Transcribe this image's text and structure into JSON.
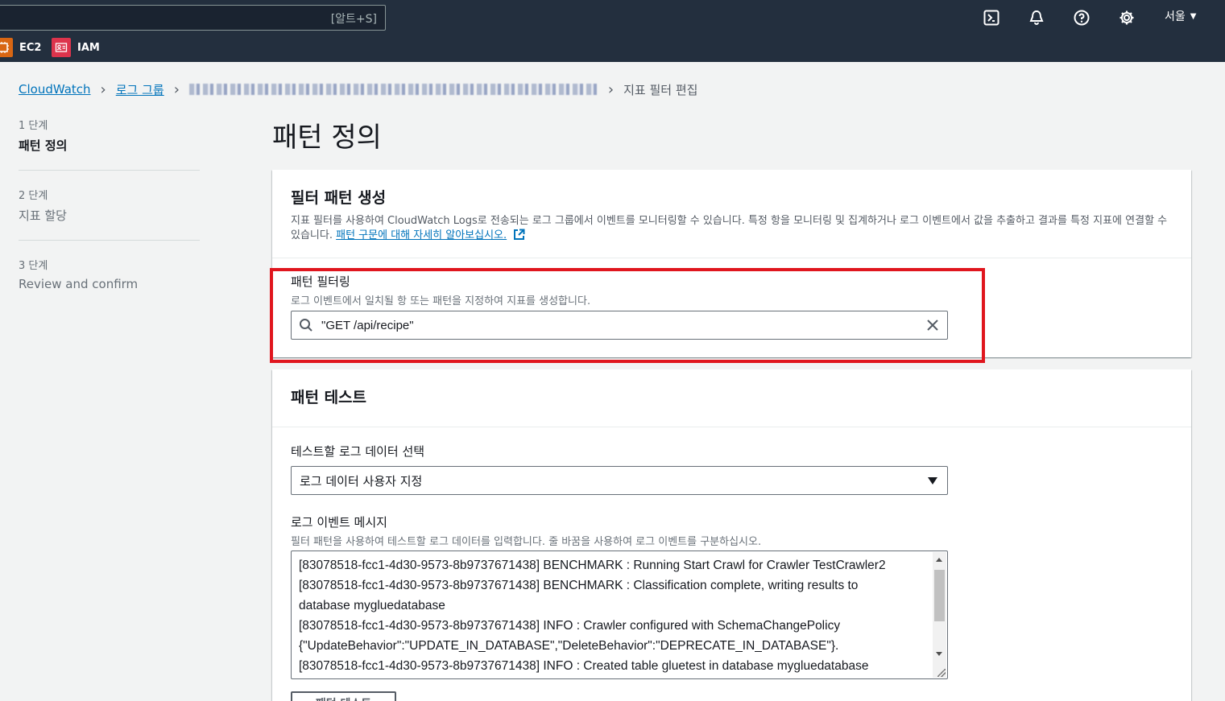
{
  "topnav": {
    "search_shortcut": "[알트+S]",
    "region": "서울",
    "favorites": [
      {
        "label": "EC2",
        "icon": "ec2-icon",
        "color": "#d86613"
      },
      {
        "label": "IAM",
        "icon": "iam-icon",
        "color": "#dd344c"
      }
    ]
  },
  "breadcrumb": {
    "items": [
      "CloudWatch",
      "로그 그룹"
    ],
    "current": "지표 필터 편집"
  },
  "steps": [
    {
      "num": "1 단계",
      "title": "패턴 정의"
    },
    {
      "num": "2 단계",
      "title": "지표 할당"
    },
    {
      "num": "3 단계",
      "title": "Review and confirm"
    }
  ],
  "page_title": "패턴 정의",
  "create_panel": {
    "title": "필터 패턴 생성",
    "description": "지표 필터를 사용하여 CloudWatch Logs로 전송되는 로그 그룹에서 이벤트를 모니터링할 수 있습니다. 특정 항을 모니터링 및 집계하거나 로그 이벤트에서 값을 추출하고 결과를 특정 지표에 연결할 수 있습니다.",
    "learn_more": "패턴 구문에 대해 자세히 알아보십시오.",
    "filter_label": "패턴 필터링",
    "filter_desc": "로그 이벤트에서 일치될 항 또는 패턴을 지정하여 지표를 생성합니다.",
    "filter_value": "\"GET /api/recipe\""
  },
  "test_panel": {
    "title": "패턴 테스트",
    "select_label": "테스트할 로그 데이터 선택",
    "select_value": "로그 데이터 사용자 지정",
    "message_label": "로그 이벤트 메시지",
    "message_desc": "필터 패턴을 사용하여 테스트할 로그 데이터를 입력합니다. 줄 바꿈을 사용하여 로그 이벤트를 구분하십시오.",
    "log_lines": [
      "[83078518-fcc1-4d30-9573-8b9737671438] BENCHMARK : Running Start Crawl for Crawler TestCrawler2",
      "[83078518-fcc1-4d30-9573-8b9737671438] BENCHMARK : Classification complete, writing results to",
      "database mygluedatabase",
      "[83078518-fcc1-4d30-9573-8b9737671438] INFO : Crawler configured with SchemaChangePolicy",
      "{\"UpdateBehavior\":\"UPDATE_IN_DATABASE\",\"DeleteBehavior\":\"DEPRECATE_IN_DATABASE\"}.",
      "[83078518-fcc1-4d30-9573-8b9737671438] INFO : Created table gluetest in database mygluedatabase"
    ],
    "test_button": "패턴 테스트"
  },
  "colors": {
    "nav_bg": "#232f3e",
    "link": "#0073bb",
    "highlight": "#e0161e"
  }
}
